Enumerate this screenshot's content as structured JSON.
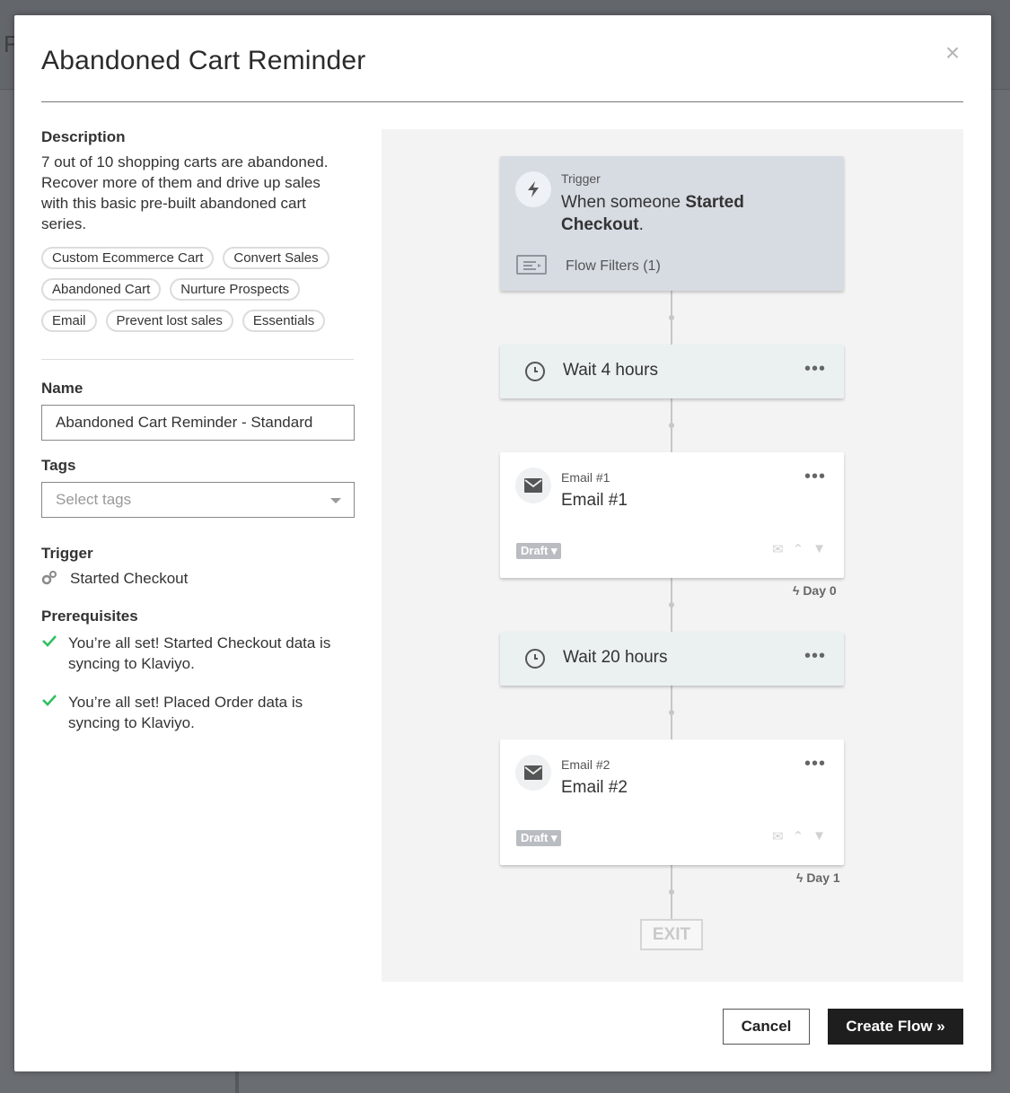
{
  "background": {
    "letter": "F"
  },
  "modal": {
    "title": "Abandoned Cart Reminder",
    "close_label": "×"
  },
  "description": {
    "label": "Description",
    "text": "7 out of 10 shopping carts are abandoned. Recover more of them and drive up sales with this basic pre-built abandoned cart series.",
    "tags": [
      "Custom Ecommerce Cart",
      "Convert Sales",
      "Abandoned Cart",
      "Nurture Prospects",
      "Email",
      "Prevent lost sales",
      "Essentials"
    ]
  },
  "form": {
    "name_label": "Name",
    "name_value": "Abandoned Cart Reminder - Standard",
    "tags_label": "Tags",
    "tags_placeholder": "Select tags"
  },
  "trigger": {
    "label": "Trigger",
    "value": "Started Checkout"
  },
  "prerequisites": {
    "label": "Prerequisites",
    "items": [
      "You’re all set! Started Checkout data is syncing to Klaviyo.",
      "You’re all set! Placed Order data is syncing to Klaviyo."
    ]
  },
  "flow": {
    "trigger_card": {
      "small": "Trigger",
      "text_prefix": "When someone ",
      "text_bold": "Started Checkout",
      "text_suffix": ".",
      "filter_label": "Flow Filters (1)"
    },
    "wait1": {
      "label": "Wait 4 hours",
      "menu": "•••"
    },
    "email1": {
      "small": "Email #1",
      "big": "Email #1",
      "badge": "Draft ▾",
      "menu": "•••",
      "day": "Day 0"
    },
    "wait2": {
      "label": "Wait 20 hours",
      "menu": "•••"
    },
    "email2": {
      "small": "Email #2",
      "big": "Email #2",
      "badge": "Draft ▾",
      "menu": "•••",
      "day": "Day 1"
    },
    "exit_label": "EXIT"
  },
  "footer": {
    "cancel_label": "Cancel",
    "create_label": "Create Flow »"
  },
  "colors": {
    "accent_dark": "#1e1e1e",
    "check_green": "#2ebf5e",
    "trigger_card_bg": "#d7dce3",
    "wait_card_bg": "#ebf0f0"
  }
}
